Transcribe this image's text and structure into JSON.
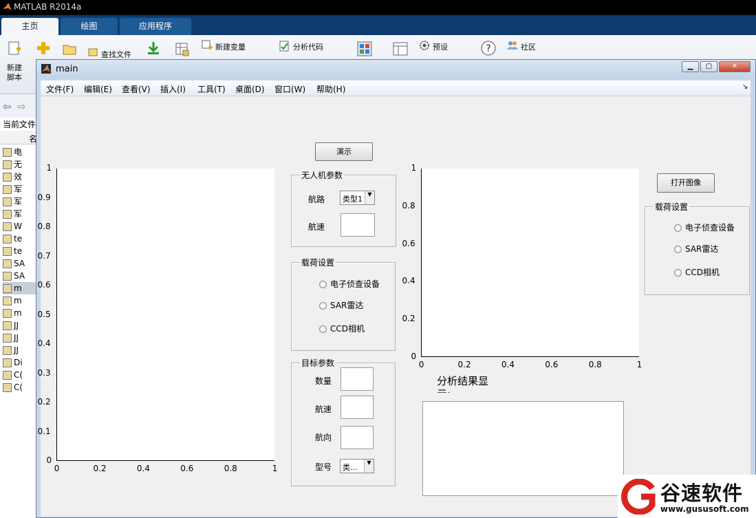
{
  "app": {
    "title": "MATLAB R2014a"
  },
  "ribbon": {
    "tabs": [
      "主页",
      "绘图",
      "应用程序"
    ],
    "new_script": "新建\n脚本",
    "find_files": "查找文件",
    "new_variable": "新建变量",
    "analyze_code": "分析代码",
    "preferences": "预设",
    "community": "社区"
  },
  "left": {
    "current_folder": "当前文件",
    "col_name": "名",
    "files": [
      "电",
      "无",
      "效",
      "军",
      "军",
      "军",
      "W",
      "te",
      "te",
      "SA",
      "SA",
      "m",
      "m",
      "m",
      "JJ",
      "JJ",
      "JJ",
      "Di",
      "C(",
      "C("
    ]
  },
  "figure": {
    "title": "main",
    "menu": [
      "文件(F)",
      "编辑(E)",
      "查看(V)",
      "插入(I)",
      "工具(T)",
      "桌面(D)",
      "窗口(W)",
      "帮助(H)"
    ],
    "demo_button": "演示",
    "open_image_button": "打开图像",
    "uav_panel": {
      "title": "无人机参数",
      "route_label": "航路",
      "route_value": "类型1",
      "speed_label": "航速"
    },
    "payload_panel": {
      "title": "载荷设置",
      "options": [
        "电子侦查设备",
        "SAR雷达",
        "CCD相机"
      ]
    },
    "payload_panel2": {
      "title": "载荷设置",
      "options": [
        "电子侦查设备",
        "SAR雷达",
        "CCD相机"
      ]
    },
    "target_panel": {
      "title": "目标参数",
      "count_label": "数量",
      "speed_label": "航速",
      "heading_label": "航向",
      "type_label": "型号",
      "type_value": "类..."
    },
    "analysis_label": "分析结果显示:",
    "axes1": {
      "y_ticks": [
        "1",
        "0.9",
        "0.8",
        "0.7",
        "0.6",
        "0.5",
        "0.4",
        "0.3",
        "0.2",
        "0.1",
        "0"
      ],
      "x_ticks": [
        "0",
        "0.2",
        "0.4",
        "0.6",
        "0.8",
        "1"
      ]
    },
    "axes2": {
      "y_ticks": [
        "1",
        "0.8",
        "0.6",
        "0.4",
        "0.2",
        "0"
      ],
      "x_ticks": [
        "0",
        "0.2",
        "0.4",
        "0.6",
        "0.8",
        "1"
      ]
    }
  },
  "watermark": {
    "brand": "谷速软件",
    "url": "www.gususoft.com"
  }
}
